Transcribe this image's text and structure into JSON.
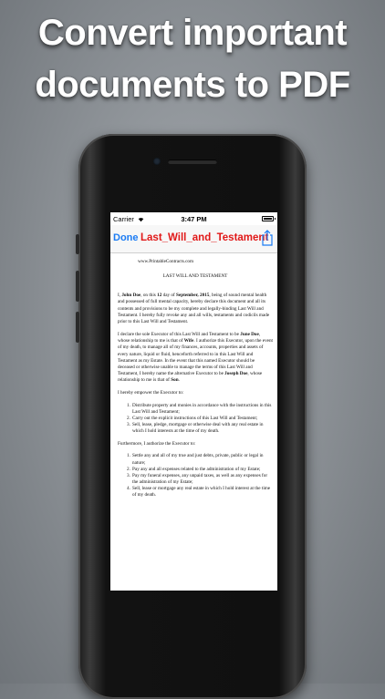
{
  "headline": {
    "line1": "Convert important",
    "line2": "documents to PDF"
  },
  "status_bar": {
    "carrier": "Carrier",
    "time": "3:47 PM"
  },
  "nav": {
    "done": "Done",
    "title": "Last_Will_and_Testament"
  },
  "document": {
    "site": "www.PrintableContracts.com",
    "heading": "LAST WILL AND TESTAMENT",
    "p1": {
      "pre": "I, ",
      "name": "John Doe",
      "mid1": ", on this ",
      "day": "12",
      "mid2": " day of ",
      "month": "September, 2015",
      "rest": ", being of sound mental health and possessed of full mental capacity, hereby declare this document and all its contents and provisions to be my complete and legally-binding Last Will and Testament. I hereby fully revoke any and all wills, testaments and codicils made prior to this Last Will and Testament."
    },
    "p2": {
      "pre": "I declare the sole Executor of this Last Will and Testament to be ",
      "exec": "June Doe",
      "mid1": ", whose relationship to me is that of ",
      "rel1": "Wife",
      "mid2": ". I authorize this Executor, upon the event of my death, to manage all of my finances, accounts, properties and assets of every nature, liquid or fluid, henceforth referred to in this Last Will and Testament as my Estate. In the event that this named Executor should be deceased or otherwise unable to manage the terms of this Last Will and Testament, I hereby name the alternative Executor to be ",
      "alt": "Joseph Doe",
      "mid3": ", whose relationship to me is that of ",
      "rel2": "Son",
      "end": "."
    },
    "empower_intro": "I hereby empower the Executor to:",
    "empower_items": [
      {
        "num": "1.",
        "text": "Distribute property and monies in accordance with the instructions in this Last Will and Testament;"
      },
      {
        "num": "2.",
        "text": "Carry out the explicit instructions of this Last Will and Testament;"
      },
      {
        "num": "3.",
        "text": "Sell, lease, pledge, mortgage or otherwise deal with any real estate in which I hold interests at the time of my death."
      }
    ],
    "authorize_intro": "Furthermore, I authorize the Executor to:",
    "authorize_items": [
      {
        "num": "1.",
        "text": "Settle any and all of my true and just debts, private, public or legal in nature;"
      },
      {
        "num": "2.",
        "text": "Pay any and all expenses related to the administration of my Estate;"
      },
      {
        "num": "3.",
        "text": "Pay my funeral expenses, any unpaid taxes, as well as any expenses for the administration of my Estate;"
      },
      {
        "num": "4.",
        "text": "Sell, lease or mortgage any real estate in which I hold interest at the time of my death."
      }
    ]
  },
  "colors": {
    "done": "#1c7cf4",
    "title": "#e11818",
    "phone_body": "#111111"
  },
  "icons": {
    "share": "share-icon",
    "wifi": "wifi-icon",
    "battery": "battery-icon"
  }
}
